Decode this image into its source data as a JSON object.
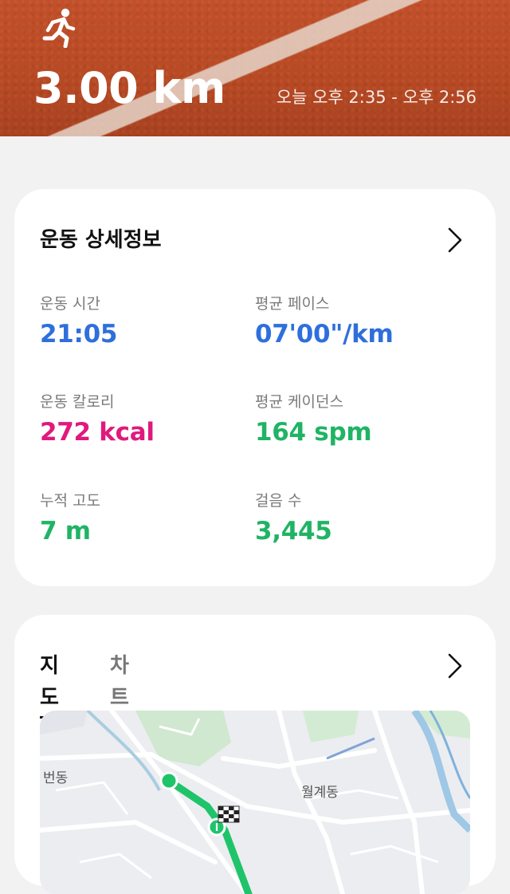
{
  "header": {
    "activity_icon": "running-person-icon",
    "distance": "3.00 km",
    "time_range": "오늘 오후 2:35 - 오후 2:56",
    "colors": {
      "track": "#b84a24"
    }
  },
  "details": {
    "title": "운동 상세정보",
    "stats": [
      {
        "label": "운동 시간",
        "value": "21:05",
        "color": "#2e6fdc"
      },
      {
        "label": "평균 페이스",
        "value": "07'00\"/km",
        "color": "#2e6fdc"
      },
      {
        "label": "운동 칼로리",
        "value": "272 kcal",
        "color": "#e0197d"
      },
      {
        "label": "평균 케이던스",
        "value": "164 spm",
        "color": "#1fb464"
      },
      {
        "label": "누적 고도",
        "value": "7 m",
        "color": "#1fb464"
      },
      {
        "label": "걸음 수",
        "value": "3,445",
        "color": "#1fb464"
      }
    ]
  },
  "map_card": {
    "tabs": [
      {
        "label": "지도",
        "active": true
      },
      {
        "label": "차트",
        "active": false
      }
    ],
    "map_labels": [
      "번동",
      "월계동"
    ],
    "route_color": "#1fc46a"
  }
}
